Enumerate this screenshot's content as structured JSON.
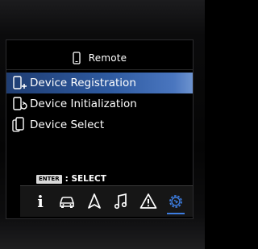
{
  "header": {
    "title": "Remote",
    "icon": "phone-icon"
  },
  "menu": {
    "items": [
      {
        "label": "Device Registration",
        "icon": "phone-add-icon",
        "selected": true
      },
      {
        "label": "Device Initialization",
        "icon": "phone-reset-icon",
        "selected": false
      },
      {
        "label": "Device Select",
        "icon": "phone-select-icon",
        "selected": false
      }
    ]
  },
  "hint": {
    "key": "ENTER",
    "action": ": SELECT"
  },
  "tabs": [
    {
      "name": "info",
      "icon": "info-icon",
      "active": false
    },
    {
      "name": "vehicle",
      "icon": "car-icon",
      "active": false
    },
    {
      "name": "navigation",
      "icon": "navigation-arrow-icon",
      "active": false
    },
    {
      "name": "audio",
      "icon": "music-note-icon",
      "active": false
    },
    {
      "name": "warning",
      "icon": "warning-icon",
      "active": false
    },
    {
      "name": "settings",
      "icon": "gear-icon",
      "active": true
    }
  ],
  "colors": {
    "highlight": "#2e5aa0",
    "active_tab": "#3d7de0",
    "background": "#000000"
  }
}
